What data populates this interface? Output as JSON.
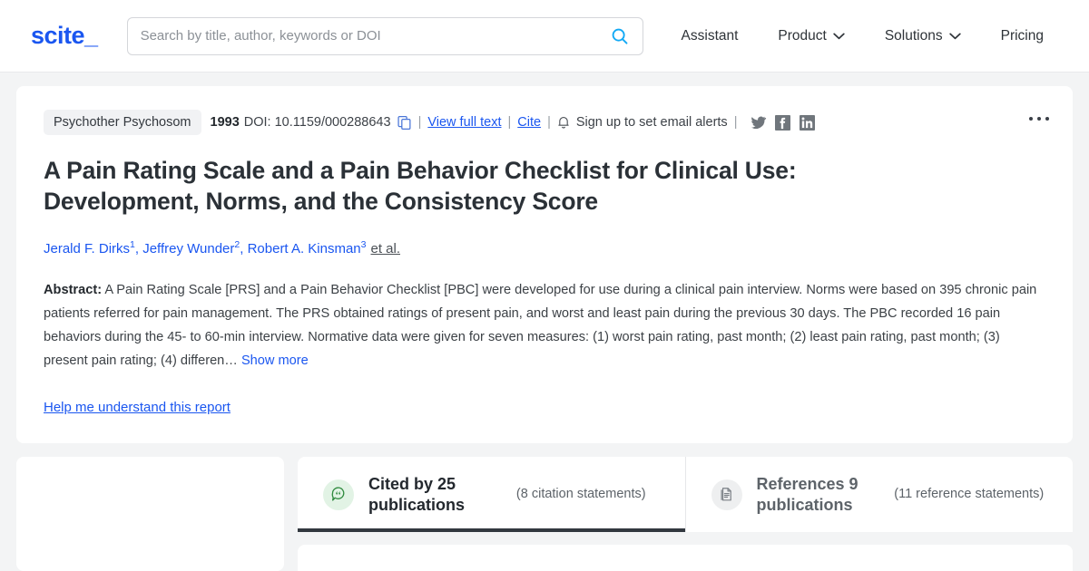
{
  "header": {
    "logo_text": "scite_",
    "logo_color": "#1a56f0",
    "search": {
      "placeholder": "Search by title, author, keywords or DOI",
      "value": "",
      "icon": "search-icon"
    },
    "nav": [
      {
        "label": "Assistant",
        "has_chevron": false
      },
      {
        "label": "Product",
        "has_chevron": true
      },
      {
        "label": "Solutions",
        "has_chevron": true
      },
      {
        "label": "Pricing",
        "has_chevron": false
      }
    ]
  },
  "paper": {
    "journal": "Psychother Psychosom",
    "year": "1993",
    "doi_label": "DOI: 10.1159/000288643",
    "copy_icon": "copy-icon",
    "sep": "|",
    "view_full_text": "View full text",
    "cite": "Cite",
    "bell_icon": "bell-icon",
    "email_alerts": "Sign up to set email alerts",
    "socials": [
      "twitter-icon",
      "facebook-icon",
      "linkedin-icon"
    ],
    "more_menu": "kebab-menu-icon",
    "title": "A Pain Rating Scale and a Pain Behavior Checklist for Clinical Use: Development, Norms, and the Consistency Score",
    "authors": [
      {
        "name": "Jerald F. Dirks",
        "affiliation": "1"
      },
      {
        "name": "Jeffrey Wunder",
        "affiliation": "2"
      },
      {
        "name": "Robert A. Kinsman",
        "affiliation": "3"
      }
    ],
    "et_al": "et al.",
    "abstract_label": "Abstract:",
    "abstract_text": "A Pain Rating Scale [PRS] and a Pain Behavior Checklist [PBC] were developed for use during a clinical pain interview. Norms were based on 395 chronic pain patients referred for pain management. The PRS obtained ratings of present pain, and worst and least pain during the previous 30 days. The PBC recorded 16 pain behaviors during the 45- to 60-min interview. Normative data were given for seven measures: (1) worst pain rating, past month; (2) least pain rating, past month; (3) present pain rating; (4) differen…",
    "show_more": "Show more",
    "help_link": "Help me understand this report"
  },
  "tabs": [
    {
      "main": "Cited by 25 publications",
      "sub": "(8 citation statements)",
      "icon": "citation-bubble-icon",
      "active": true,
      "accent": "#2f8a3e"
    },
    {
      "main": "References 9 publications",
      "sub": "(11 reference statements)",
      "icon": "document-icon",
      "active": false,
      "accent": "#7b8086"
    }
  ]
}
